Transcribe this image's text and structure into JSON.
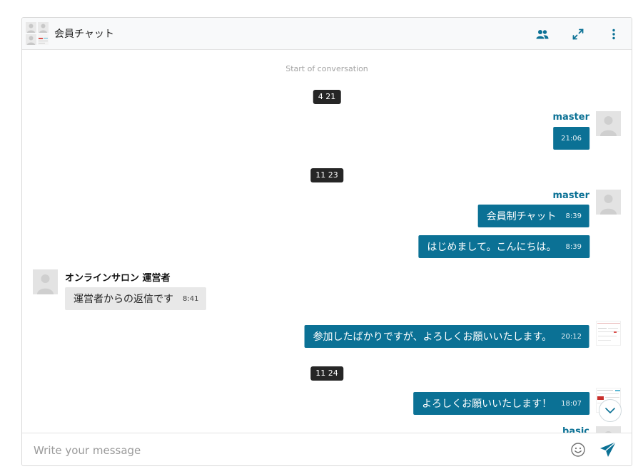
{
  "header": {
    "title": "会員チャット",
    "icons": [
      "members-icon",
      "expand-icon",
      "more-vertical-icon"
    ]
  },
  "conversation": {
    "start_label": "Start of conversation",
    "dates": [
      "4 21",
      "11 23",
      "11 24"
    ]
  },
  "messages": [
    {
      "sender": "master",
      "text": "",
      "time": "21:06",
      "mine": true
    },
    {
      "sender": "master",
      "text": "会員制チャット",
      "time": "8:39",
      "mine": true
    },
    {
      "sender": "",
      "text": "はじめまして。こんにちは。",
      "time": "8:39",
      "mine": true
    },
    {
      "sender": "オンラインサロン 運営者",
      "text": "運営者からの返信です",
      "time": "8:41",
      "mine": false
    },
    {
      "sender": "",
      "text": "参加したばかりですが、よろしくお願いいたします。",
      "time": "20:12",
      "mine": true
    },
    {
      "sender": "",
      "text": "よろしくお願いいたします！",
      "time": "18:07",
      "mine": true
    },
    {
      "sender": "basic",
      "text": "",
      "time": "",
      "mine": true
    }
  ],
  "composer": {
    "placeholder": "Write your message"
  },
  "colors": {
    "accent": "#0b7195",
    "date_chip": "#262626",
    "incoming_bubble": "#e8e8e8",
    "header_bg": "#f8f9fa"
  }
}
